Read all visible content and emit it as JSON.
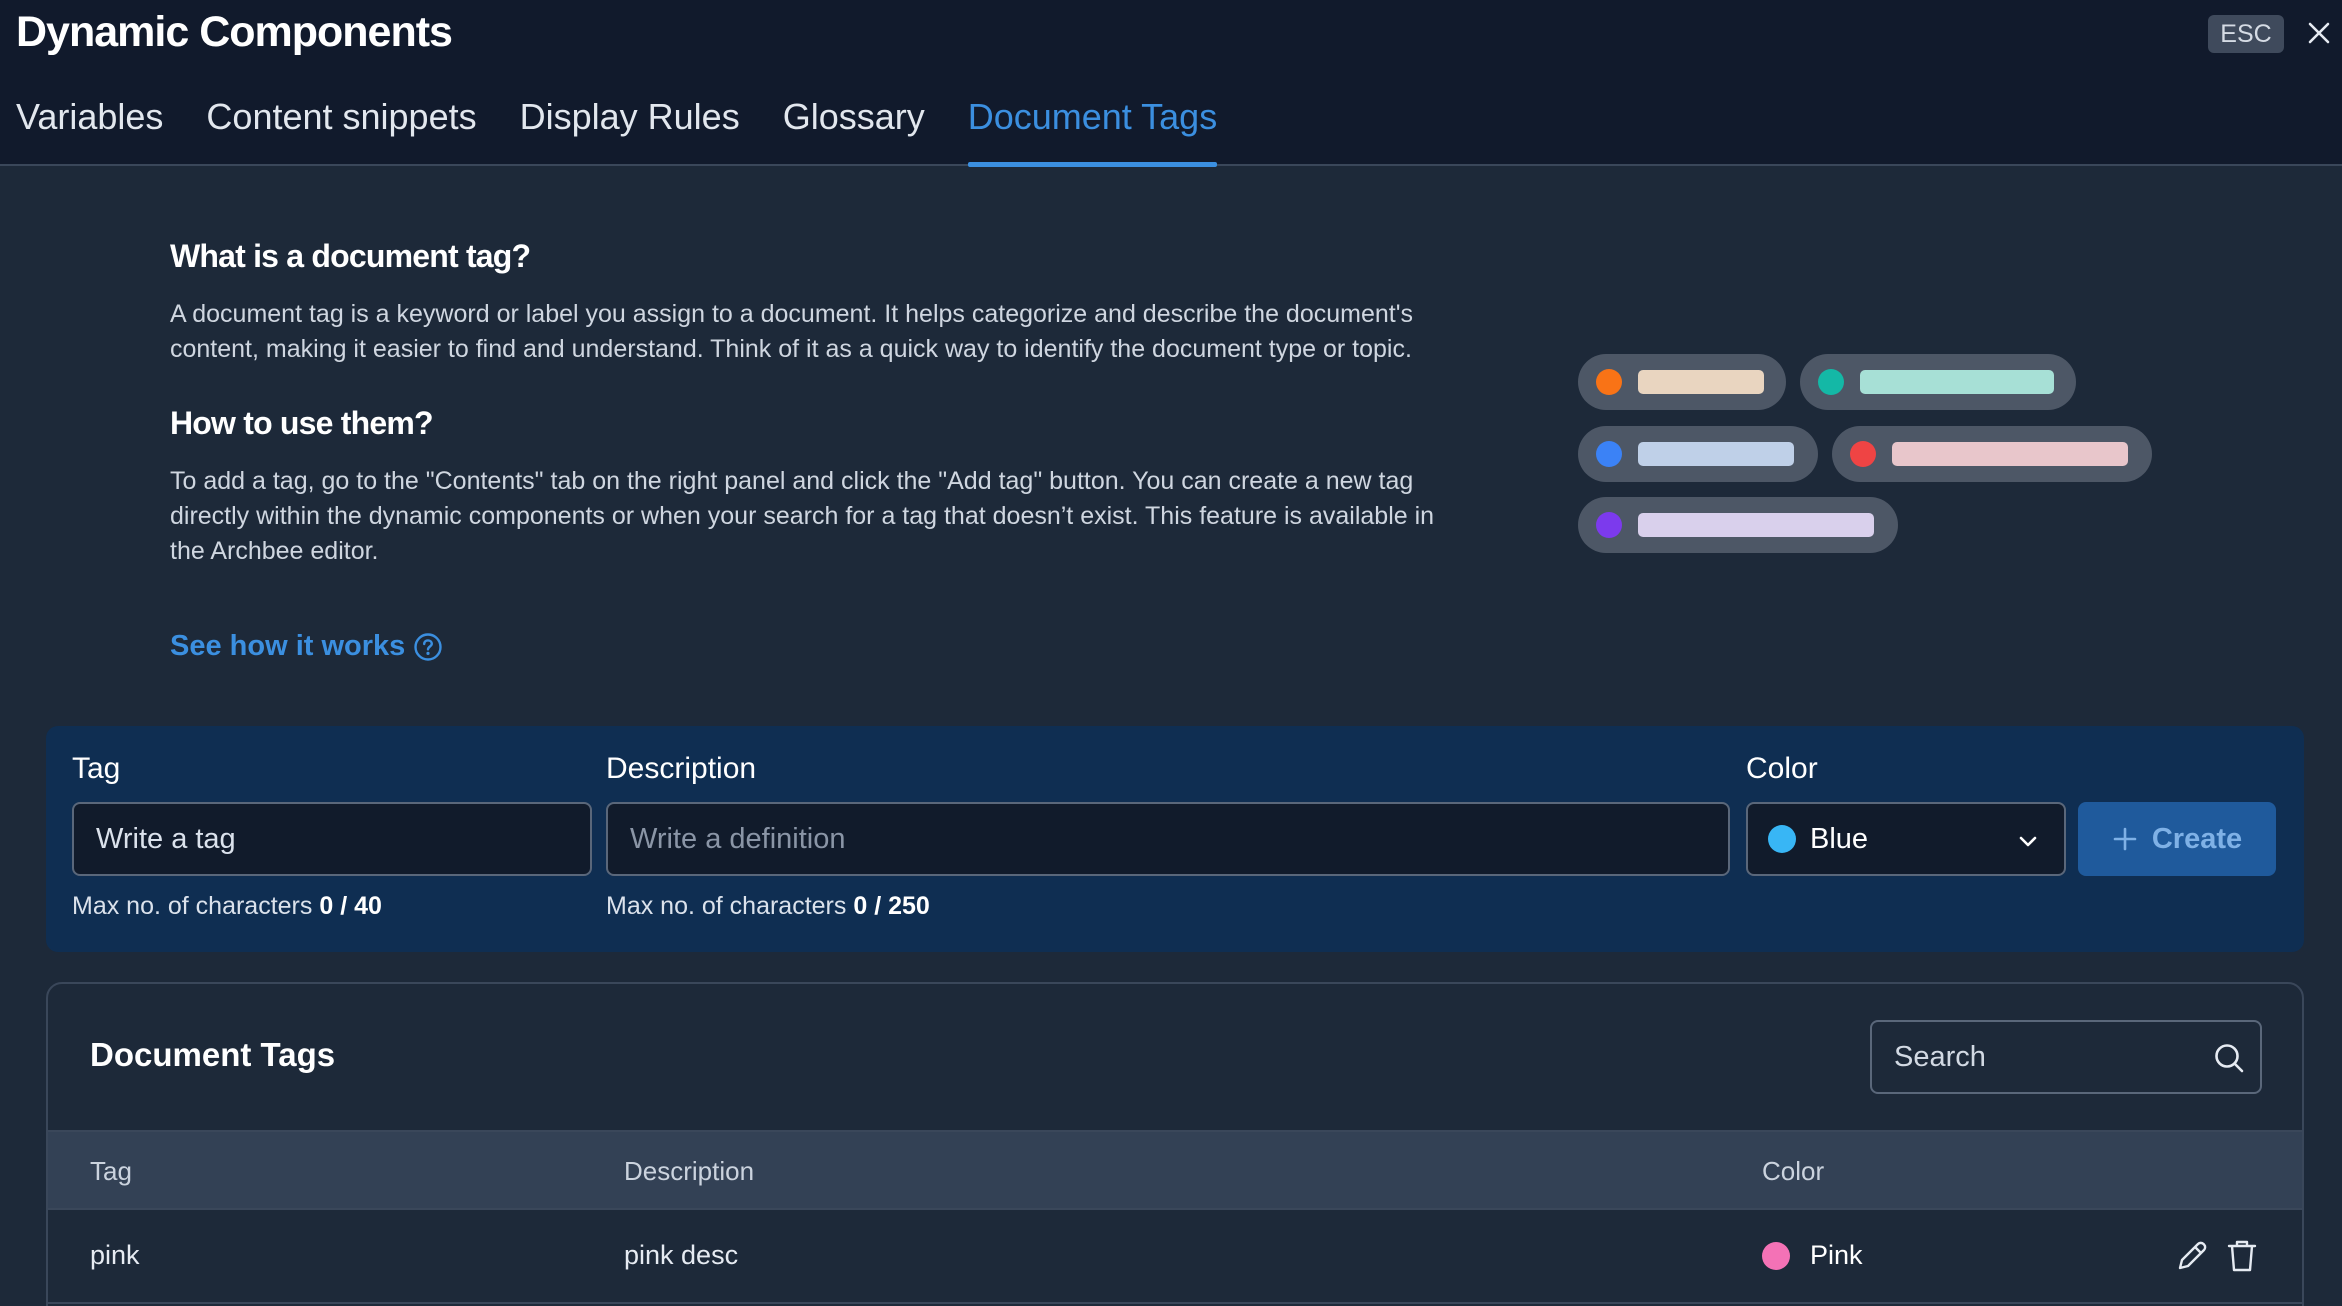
{
  "header": {
    "title": "Dynamic Components",
    "esc_label": "ESC",
    "tabs": [
      {
        "label": "Variables"
      },
      {
        "label": "Content snippets"
      },
      {
        "label": "Display Rules"
      },
      {
        "label": "Glossary"
      },
      {
        "label": "Document Tags",
        "active": true
      }
    ]
  },
  "info": {
    "heading1": "What is a document tag?",
    "paragraph1": "A document tag is a keyword or label you assign to a document. It helps categorize and describe the document's content, making it easier to find and understand. Think of it as a quick way to identify the document type or topic.",
    "heading2": "How to use them?",
    "paragraph2": "To add a tag, go to the \"Contents\" tab on the right panel and click the \"Add tag\" button. You can create a new tag directly within the dynamic components or when your search for a tag that doesn’t exist. This feature is available in the Archbee editor.",
    "link_label": "See how it works"
  },
  "illustration": {
    "pills": [
      {
        "dot": "#f97316",
        "bar": "#e9d5c0"
      },
      {
        "dot": "#14b8a6",
        "bar": "#a7e0d6"
      },
      {
        "dot": "#3b82f6",
        "bar": "#bfd0e8"
      },
      {
        "dot": "#ef4444",
        "bar": "#e8c6cb"
      },
      {
        "dot": "#7c3aed",
        "bar": "#d9d0ec"
      }
    ]
  },
  "create_form": {
    "tag_label": "Tag",
    "tag_value": "Write a tag",
    "tag_hint_prefix": "Max no. of characters",
    "tag_hint_count": "0 / 40",
    "description_label": "Description",
    "description_placeholder": "Write a definition",
    "description_hint_prefix": "Max no. of characters",
    "description_hint_count": "0 / 250",
    "color_label": "Color",
    "color_value": "Blue",
    "color_value_hex": "#38b6f5",
    "create_label": "Create"
  },
  "table": {
    "title": "Document Tags",
    "search_placeholder": "Search",
    "columns": [
      "Tag",
      "Description",
      "Color"
    ],
    "rows": [
      {
        "tag": "pink",
        "description": "pink desc",
        "color": "Pink",
        "color_hex": "#f472b6"
      }
    ]
  }
}
